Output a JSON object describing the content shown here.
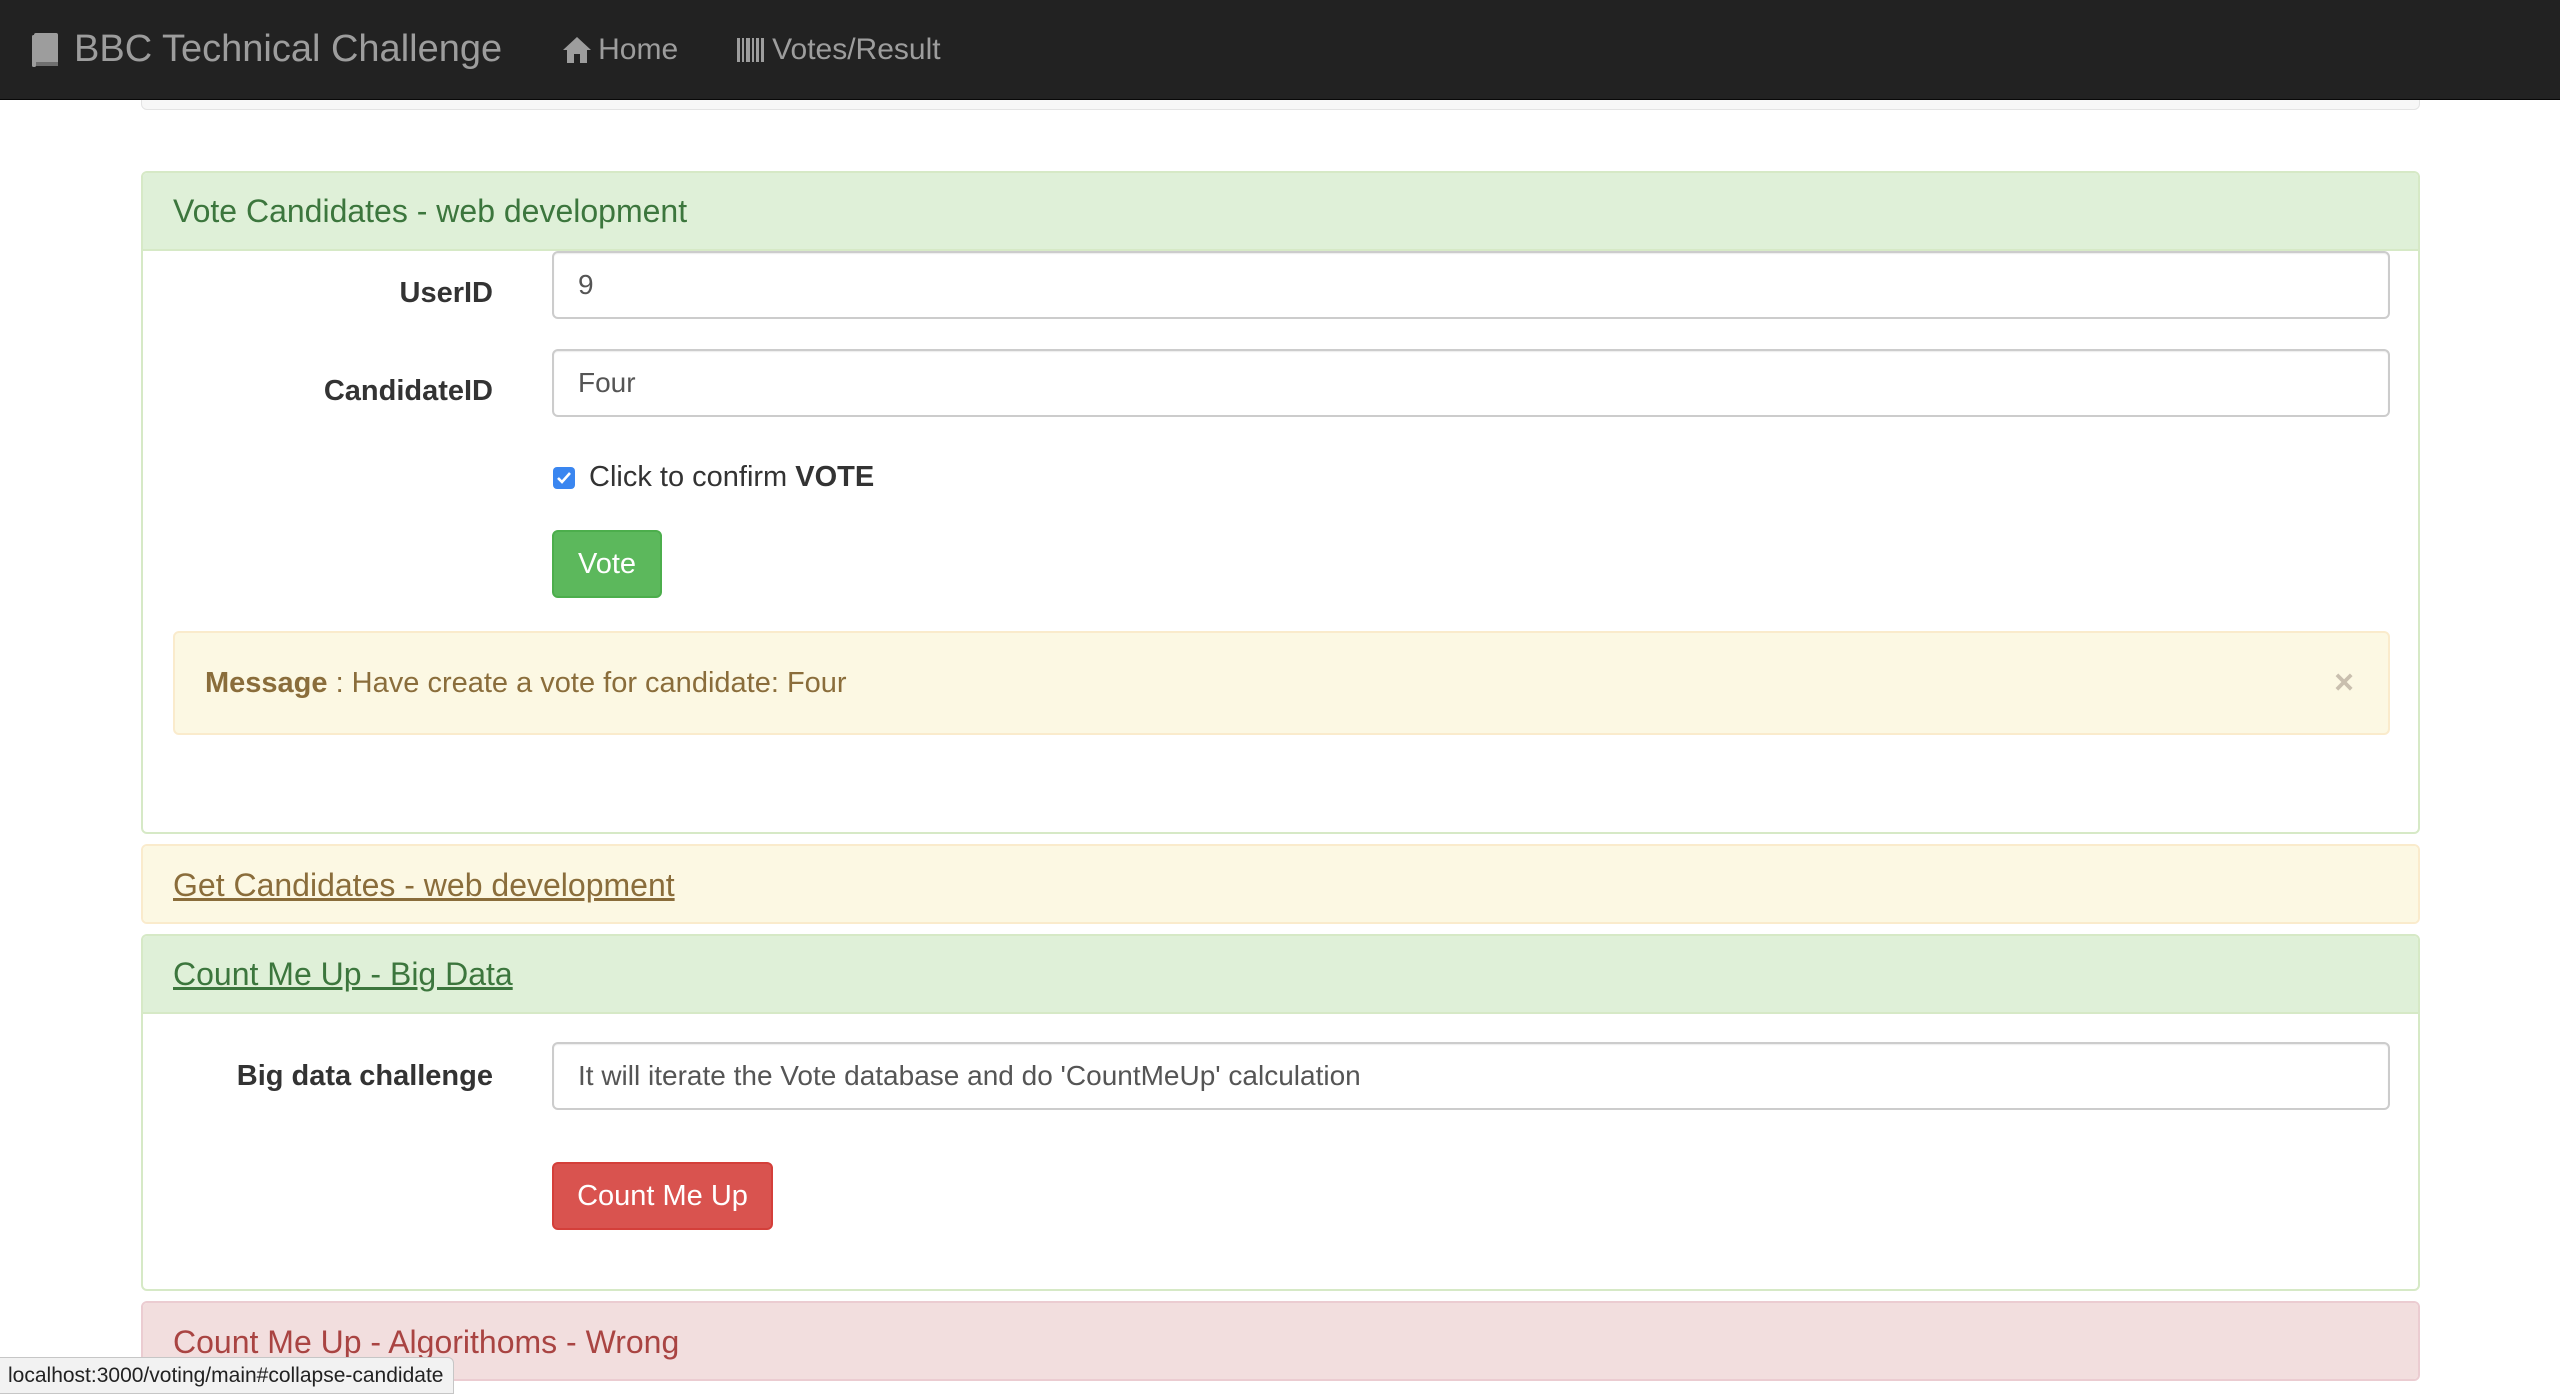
{
  "navbar": {
    "brand": "BBC Technical Challenge",
    "brand_icon": "book-icon",
    "items": [
      {
        "label": "Home",
        "icon": "home-icon"
      },
      {
        "label": "Votes/Result",
        "icon": "barcode-icon"
      }
    ],
    "background": "#222222",
    "text_color": "#9d9d9d"
  },
  "vote_panel": {
    "title": "Vote Candidates - web development",
    "userid_label": "UserID",
    "userid_value": "9",
    "candidate_label": "CandidateID",
    "candidate_value": "Four",
    "confirm_text": "Click to confirm ",
    "confirm_bold": "VOTE",
    "confirm_checked": true,
    "vote_button": "Vote",
    "message_label": "Message",
    "message_text": " : Have create a vote for candidate: Four",
    "close_symbol": "×"
  },
  "get_panel": {
    "title": "Get Candidates - web development"
  },
  "count_panel": {
    "title": "Count Me Up - Big Data",
    "challenge_label": "Big data challenge",
    "challenge_value": "It will iterate the Vote database and do 'CountMeUp' calculation",
    "count_button": "Count Me Up"
  },
  "algo_panel": {
    "title": "Count Me Up - Algorithoms - Wrong"
  },
  "status_bar": {
    "url": "localhost:3000/voting/main#collapse-candidate"
  },
  "colors": {
    "success_bg": "#dff0d8",
    "success_text": "#3c763d",
    "warning_bg": "#fcf8e3",
    "warning_text": "#8a6d3b",
    "danger_bg": "#f2dede",
    "danger_text": "#a94442",
    "btn_success": "#5cb85c",
    "btn_danger": "#d9534f"
  }
}
